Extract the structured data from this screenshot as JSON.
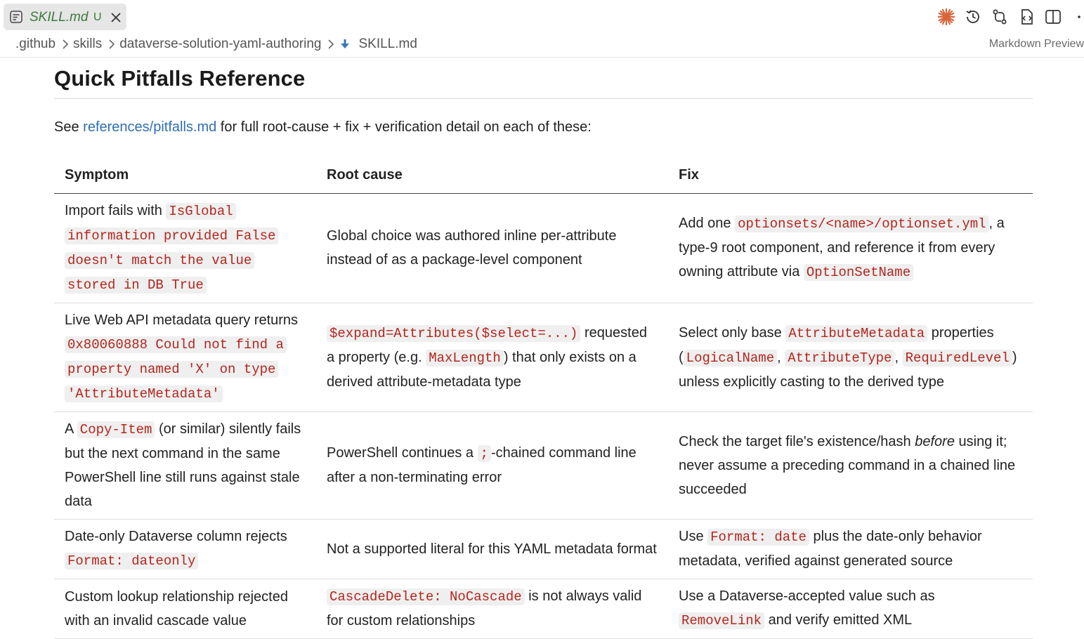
{
  "tab": {
    "filename": "SKILL.md",
    "status": "U"
  },
  "breadcrumb": {
    "items": [
      ".github",
      "skills",
      "dataverse-solution-yaml-authoring",
      "SKILL.md"
    ]
  },
  "preview_label": "Markdown Preview",
  "section": {
    "title": "Quick Pitfalls Reference",
    "intro_before": "See ",
    "intro_link": "references/pitfalls.md",
    "intro_after": " for full root-cause + fix + verification detail on each of these:"
  },
  "table": {
    "headers": [
      "Symptom",
      "Root cause",
      "Fix"
    ],
    "rows": [
      {
        "symptom": {
          "text1": "Import fails with ",
          "code1": "IsGlobal information provided False doesn't match the value stored in DB True"
        },
        "cause": {
          "text1": "Global choice was authored inline per-attribute instead of as a package-level component"
        },
        "fix": {
          "text1": "Add one ",
          "code1": "optionsets/<name>/optionset.yml",
          "text2": ", a type-9 root component, and reference it from every owning attribute via ",
          "code2": "OptionSetName"
        }
      },
      {
        "symptom": {
          "text1": "Live Web API metadata query returns ",
          "code1": "0x80060888 Could not find a property named 'X' on type 'AttributeMetadata'"
        },
        "cause": {
          "code1": "$expand=Attributes($select=...)",
          "text1": " requested a property (e.g. ",
          "code2": "MaxLength",
          "text2": ") that only exists on a derived attribute-metadata type"
        },
        "fix": {
          "text1": "Select only base ",
          "code1": "AttributeMetadata",
          "text2": " properties (",
          "code2": "LogicalName",
          "text3": ", ",
          "code3": "AttributeType",
          "text4": ", ",
          "code4": "RequiredLevel",
          "text5": ") unless explicitly casting to the derived type"
        }
      },
      {
        "symptom": {
          "text1": "A ",
          "code1": "Copy-Item",
          "text2": " (or similar) silently fails but the next command in the same PowerShell line still runs against stale data"
        },
        "cause": {
          "text1": "PowerShell continues a ",
          "code1": ";",
          "text2": "-chained command line after a non-terminating error"
        },
        "fix": {
          "text1": "Check the target file's existence/hash ",
          "em1": "before",
          "text2": " using it; never assume a preceding command in a chained line succeeded"
        }
      },
      {
        "symptom": {
          "text1": "Date-only Dataverse column rejects ",
          "code1": "Format: dateonly"
        },
        "cause": {
          "text1": "Not a supported literal for this YAML metadata format"
        },
        "fix": {
          "text1": "Use ",
          "code1": "Format: date",
          "text2": " plus the date-only behavior metadata, verified against generated source"
        }
      },
      {
        "symptom": {
          "text1": "Custom lookup relationship rejected with an invalid cascade value"
        },
        "cause": {
          "code1": "CascadeDelete: NoCascade",
          "text1": " is not always valid for custom relationships"
        },
        "fix": {
          "text1": "Use a Dataverse-accepted value such as ",
          "code1": "RemoveLink",
          "text2": " and verify emitted XML"
        }
      }
    ]
  },
  "colors": {
    "link": "#2f6fb4",
    "code_text": "#b3261e",
    "code_bg": "#efefef",
    "tab_text": "#3c7a3c",
    "accent": "#d9653b"
  }
}
